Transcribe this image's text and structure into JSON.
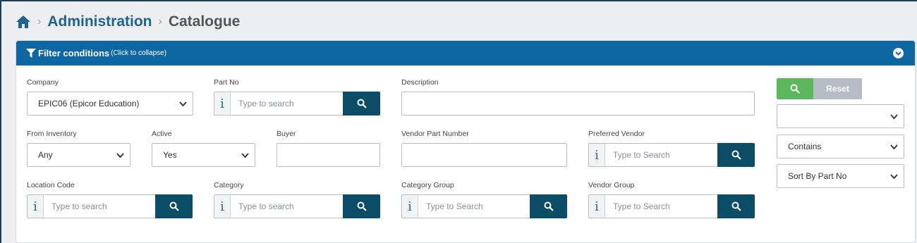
{
  "breadcrumb": {
    "home_icon": "home-icon",
    "items": [
      "Administration",
      "Catalogue"
    ]
  },
  "panel": {
    "title": "Filter conditions",
    "subtitle": "(Click to collapse)",
    "header_color": "#0e67a3"
  },
  "fields": {
    "company": {
      "label": "Company",
      "value": "EPIC06 (Epicor Education)"
    },
    "part_no": {
      "label": "Part No",
      "placeholder": "Type to search"
    },
    "description": {
      "label": "Description",
      "value": ""
    },
    "from_inventory": {
      "label": "From Inventory",
      "value": "Any"
    },
    "active": {
      "label": "Active",
      "value": "Yes"
    },
    "buyer": {
      "label": "Buyer",
      "value": ""
    },
    "vendor_part_number": {
      "label": "Vendor Part Number",
      "value": ""
    },
    "preferred_vendor": {
      "label": "Preferred Vendor",
      "placeholder": "Type to Search"
    },
    "location_code": {
      "label": "Location Code",
      "placeholder": "Type to search"
    },
    "category": {
      "label": "Category",
      "placeholder": "Type to search"
    },
    "category_group": {
      "label": "Category Group",
      "placeholder": "Type to Search"
    },
    "vendor_group": {
      "label": "Vendor Group",
      "placeholder": "Type to Search"
    }
  },
  "side": {
    "reset_label": "Reset",
    "field_select": "",
    "match_select": "Contains",
    "sort_select": "Sort By Part No"
  },
  "info_glyph": "i",
  "colors": {
    "brand": "#1f6391",
    "search_button": "#5cb85c",
    "lookup_button": "#0b4c66",
    "reset_button": "#b6bcc3"
  }
}
